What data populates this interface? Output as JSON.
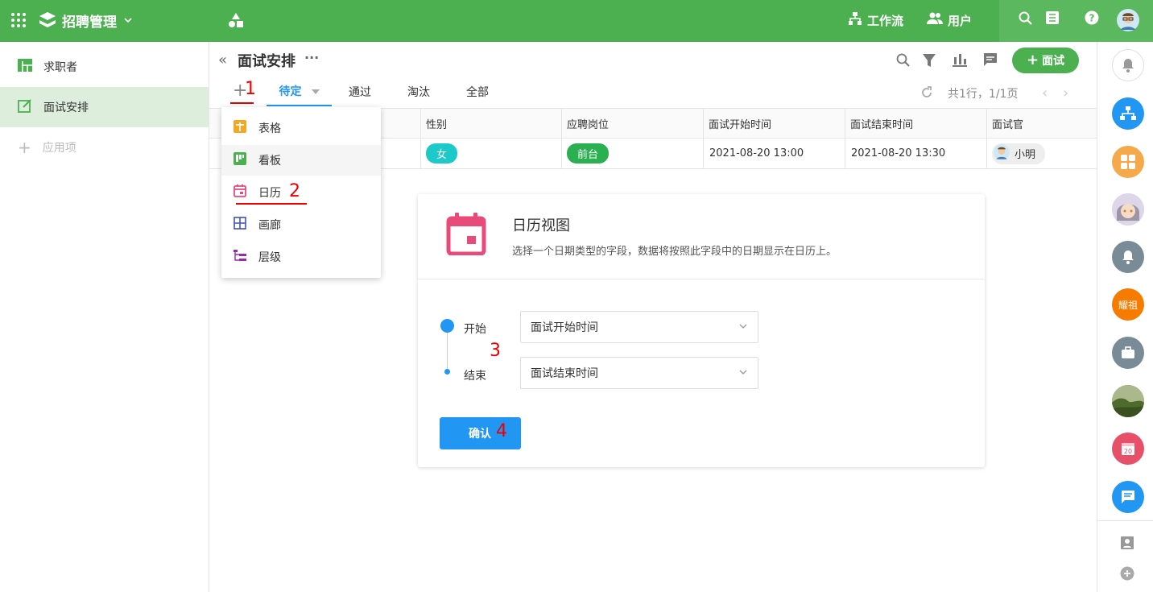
{
  "app": {
    "title": "招聘管理",
    "nav": {
      "workflow": "工作流",
      "users": "用户"
    }
  },
  "sidebar": {
    "items": [
      {
        "label": "求职者"
      },
      {
        "label": "面试安排"
      }
    ],
    "add_label": "应用项"
  },
  "sheet": {
    "title": "面试安排",
    "add_button": "面试",
    "tabs": [
      "待定",
      "通过",
      "淘汰",
      "全部"
    ],
    "pager": "共1行，1/1页"
  },
  "grid": {
    "columns": [
      "性别",
      "应聘岗位",
      "面试开始时间",
      "面试结束时间",
      "面试官"
    ],
    "row": {
      "gender": "女",
      "position": "前台",
      "start": "2021-08-20 13:00",
      "end": "2021-08-20 13:30",
      "interviewer": "小明"
    }
  },
  "view_menu": {
    "items": [
      "表格",
      "看板",
      "日历",
      "画廊",
      "层级"
    ]
  },
  "calendar_card": {
    "title": "日历视图",
    "description": "选择一个日期类型的字段，数据将按照此字段中的日期显示在日历上。",
    "start_label": "开始",
    "start_value": "面试开始时间",
    "end_label": "结束",
    "end_value": "面试结束时间",
    "confirm": "确认"
  },
  "rightbar": {
    "orange_badge": "耀祖",
    "calendar_day": "20"
  },
  "annotations": [
    "1",
    "2",
    "3",
    "4"
  ],
  "colors": {
    "brand": "#4caf50",
    "accent": "#2196f3",
    "calendar_pink": "#e84a7a",
    "tag_cyan": "#1dc9c9",
    "tag_green": "#2ab050"
  }
}
